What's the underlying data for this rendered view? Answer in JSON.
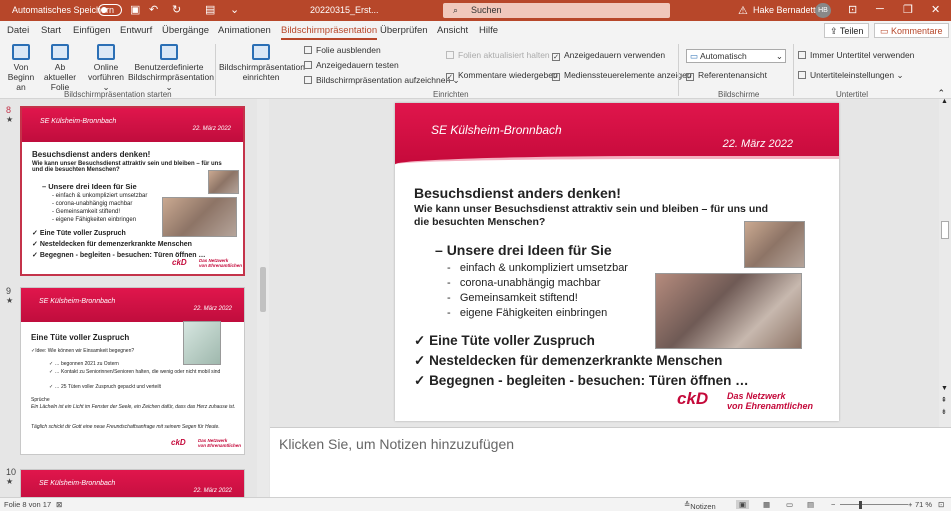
{
  "titlebar": {
    "autosave": "Automatisches Speichern",
    "filename": "20220315_Erst...",
    "search": "Suchen",
    "user": "Hake Bernadette",
    "initials": "HB"
  },
  "menu": {
    "tabs": [
      "Datei",
      "Start",
      "Einfügen",
      "Entwurf",
      "Übergänge",
      "Animationen",
      "Bildschirmpräsentation",
      "Überprüfen",
      "Ansicht",
      "Hilfe"
    ],
    "share": "Teilen",
    "comments": "Kommentare"
  },
  "ribbon": {
    "b1": [
      "Von",
      "Beginn an"
    ],
    "b2": [
      "Ab aktueller",
      "Folie"
    ],
    "b3": [
      "Online",
      "vorführen"
    ],
    "b4": [
      "Benutzerdefinierte",
      "Bildschirmpräsentation"
    ],
    "b5": [
      "Bildschirmpräsentation",
      "einrichten"
    ],
    "hide": "Folie ausblenden",
    "test": "Anzeigedauern testen",
    "record": "Bildschirmpräsentation aufzeichnen",
    "update": "Folien aktualisiert halten",
    "durations": "Anzeigedauern verwenden",
    "comments": "Kommentare wiedergeben",
    "media": "Medienssteuerelemente anzeigen",
    "monitor": "Automatisch",
    "presenter": "Referentenansicht",
    "subtitle_always": "Immer Untertitel verwenden",
    "subtitle_settings": "Untertiteleinstellungen",
    "grp1": "Bildschirmpräsentation starten",
    "grp2": "Einrichten",
    "grp3": "Bildschirme",
    "grp4": "Untertitel"
  },
  "slide8": {
    "header": "SE Külsheim-Bronnbach",
    "date": "22. März 2022",
    "title": "Besuchsdienst anders denken!",
    "subtitle": "Wie kann unser Besuchsdienst attraktiv sein und bleiben – für uns und die besuchten Menschen?",
    "ideas_heading": "Unsere drei Ideen für Sie",
    "ideas": [
      "einfach & unkompliziert umsetzbar",
      "corona-unabhängig machbar",
      "Gemeinsamkeit stiftend!",
      "eigene Fähigkeiten einbringen"
    ],
    "checks": [
      "Eine Tüte voller Zuspruch",
      "Nesteldecken für demenzerkrankte Menschen",
      "Begegnen - begleiten - besuchen: Türen öffnen …"
    ],
    "logo": "ckD",
    "tag1": "Das Netzwerk",
    "tag2": "von Ehrenamtlichen"
  },
  "slide9": {
    "title": "Eine Tüte voller Zuspruch",
    "idea": "✓Idee: Wie können wir Einsamkeit begegnen?",
    "lines": [
      "… begonnen 2021 zu Ostern",
      "… Kontakt zu Seniorinnen/Senioren halten, die wenig oder nicht mobil sind",
      "… 25 Tüten voller Zuspruch gepackt und verteilt"
    ],
    "sprueche": "Sprüche",
    "quote": "Ein Lächeln ist ein Licht im Fenster der Seele, ein Zeichen dafür, dass das Herz zuhause ist.",
    "quote2": "Täglich schickt dir Gott eine neue Freundschaftsanfrage mit seinem Segen für Heute."
  },
  "thumbs": {
    "n8": "8",
    "n9": "9",
    "n10": "10"
  },
  "notes": "Klicken Sie, um Notizen hinzuzufügen",
  "status": {
    "slide": "Folie 8 von 17",
    "notes": "Notizen",
    "zoom": "71 %"
  }
}
